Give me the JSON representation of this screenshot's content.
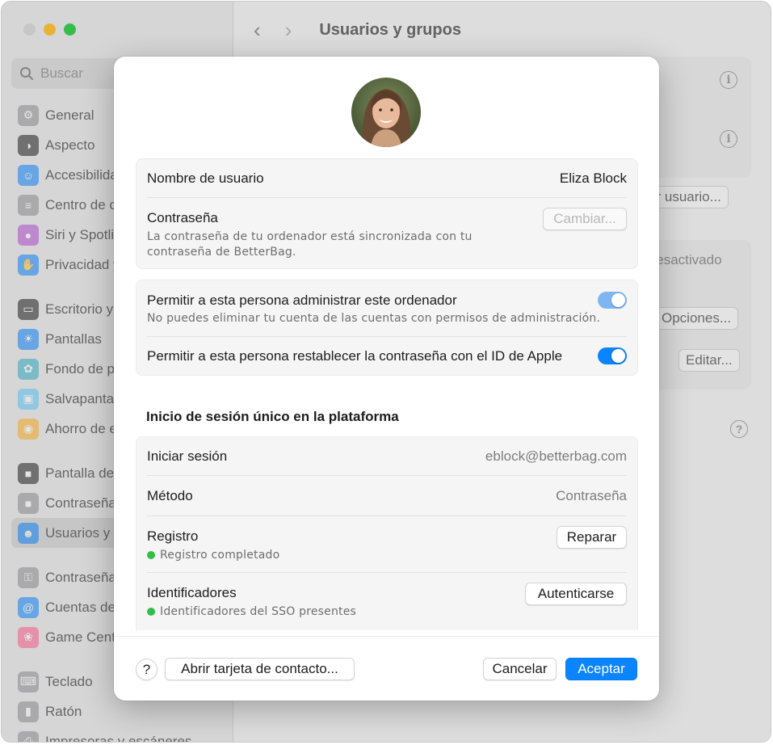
{
  "window": {
    "title": "Usuarios y grupos",
    "search_placeholder": "Buscar"
  },
  "sidebar": {
    "groups": [
      [
        {
          "label": "General",
          "icon": "gear-icon",
          "color": "#8e8e93"
        },
        {
          "label": "Aspecto",
          "icon": "appearance-icon",
          "color": "#1c1c1e"
        },
        {
          "label": "Accesibilidad",
          "icon": "accessibility-icon",
          "color": "#0a84ff"
        },
        {
          "label": "Centro de control",
          "icon": "control-center-icon",
          "color": "#8e8e93"
        },
        {
          "label": "Siri y Spotlight",
          "icon": "siri-icon",
          "color": "#b34bd6"
        },
        {
          "label": "Privacidad y seguridad",
          "icon": "hand-icon",
          "color": "#0a84ff"
        }
      ],
      [
        {
          "label": "Escritorio y Dock",
          "icon": "dock-icon",
          "color": "#1c1c1e"
        },
        {
          "label": "Pantallas",
          "icon": "sun-icon",
          "color": "#0a84ff"
        },
        {
          "label": "Fondo de pantalla",
          "icon": "wallpaper-icon",
          "color": "#30b0c7"
        },
        {
          "label": "Salvapantallas",
          "icon": "screensaver-icon",
          "color": "#5ac8fa"
        },
        {
          "label": "Ahorro de energía",
          "icon": "bulb-icon",
          "color": "#ffb020"
        }
      ],
      [
        {
          "label": "Pantalla de bloqueo",
          "icon": "lock-screen-icon",
          "color": "#1c1c1e"
        },
        {
          "label": "Contraseña de inicio",
          "icon": "lock-icon",
          "color": "#8e8e93"
        },
        {
          "label": "Usuarios y grupos",
          "icon": "users-icon",
          "color": "#0a84ff",
          "selected": true
        }
      ],
      [
        {
          "label": "Contraseñas",
          "icon": "key-icon",
          "color": "#8e8e93"
        },
        {
          "label": "Cuentas de internet",
          "icon": "at-icon",
          "color": "#0a84ff"
        },
        {
          "label": "Game Center",
          "icon": "game-center-icon",
          "color": "#ff5c8a"
        }
      ],
      [
        {
          "label": "Teclado",
          "icon": "keyboard-icon",
          "color": "#8e8e93"
        },
        {
          "label": "Ratón",
          "icon": "mouse-icon",
          "color": "#8e8e93"
        },
        {
          "label": "Impresoras y escáneres",
          "icon": "printer-icon",
          "color": "#8e8e93"
        }
      ]
    ]
  },
  "background": {
    "add_user_button": "Añadir usuario...",
    "desactivated_label": "Desactivado",
    "options_button": "Opciones...",
    "edit_button": "Editar..."
  },
  "sheet": {
    "account": {
      "username_label": "Nombre de usuario",
      "username_value": "Eliza Block",
      "password_label": "Contraseña",
      "password_note_line1": "La contraseña de tu ordenador está sincronizada con tu",
      "password_note_line2": "contraseña de BetterBag.",
      "change_button": "Cambiar..."
    },
    "permissions": {
      "admin_label": "Permitir a esta persona administrar este ordenador",
      "admin_note": "No puedes eliminar tu cuenta de las cuentas con permisos de administración.",
      "admin_enabled": true,
      "reset_label": "Permitir a esta persona restablecer la contraseña con el ID de Apple",
      "reset_enabled": true
    },
    "sso": {
      "section_title": "Inicio de sesión único en la plataforma",
      "signin_label": "Iniciar sesión",
      "signin_value": "eblock@betterbag.com",
      "method_label": "Método",
      "method_value": "Contraseña",
      "registration_label": "Registro",
      "registration_status": "Registro completado",
      "repair_button": "Reparar",
      "identifiers_label": "Identificadores",
      "identifiers_status": "Identificadores del SSO presentes",
      "authenticate_button": "Autenticarse"
    },
    "footer": {
      "help_label": "?",
      "contact_card_button": "Abrir tarjeta de contacto...",
      "cancel_button": "Cancelar",
      "ok_button": "Aceptar"
    }
  },
  "colors": {
    "accent": "#0a84ff",
    "status_green": "#30c048",
    "toggle_dimmed": "#7fb6f2"
  }
}
